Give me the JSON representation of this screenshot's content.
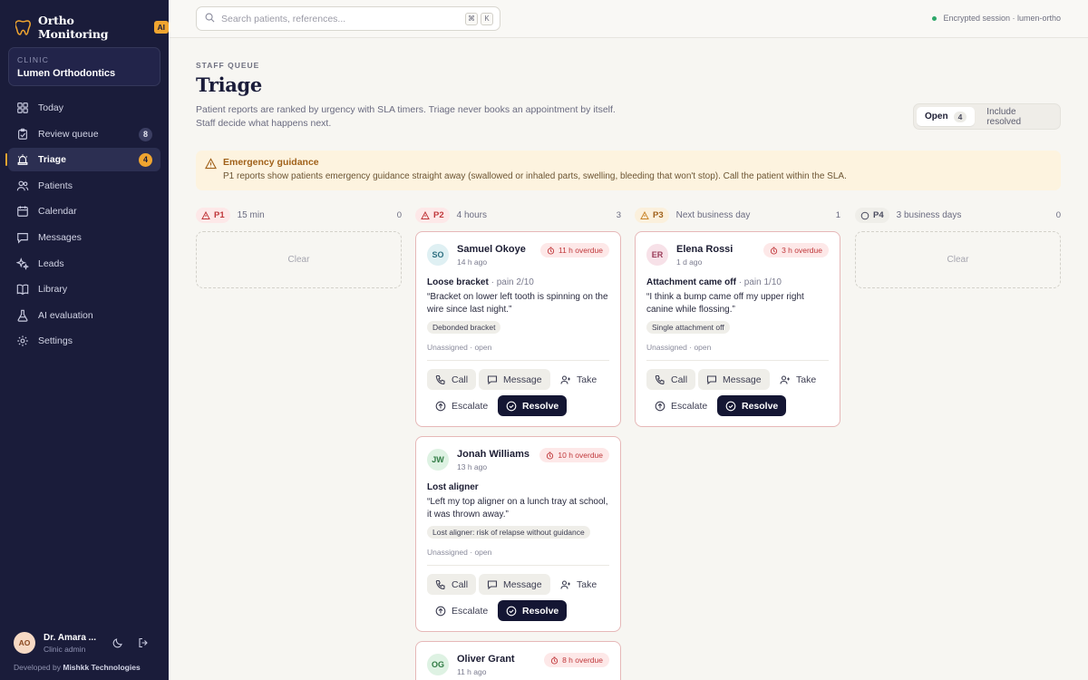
{
  "sidebar": {
    "brand": "Ortho Monitoring",
    "brand_badge": "AI",
    "clinic_caption": "CLINIC",
    "clinic_name": "Lumen Orthodontics",
    "nav": [
      {
        "label": "Today",
        "icon": "home-icon"
      },
      {
        "label": "Review queue",
        "icon": "clipboard-check-icon",
        "count": "8"
      },
      {
        "label": "Triage",
        "icon": "siren-icon",
        "count": "4"
      },
      {
        "label": "Patients",
        "icon": "users-icon"
      },
      {
        "label": "Calendar",
        "icon": "calendar-icon"
      },
      {
        "label": "Messages",
        "icon": "message-icon"
      },
      {
        "label": "Leads",
        "icon": "sparkle-icon"
      },
      {
        "label": "Library",
        "icon": "book-icon"
      },
      {
        "label": "AI evaluation",
        "icon": "flask-icon"
      },
      {
        "label": "Settings",
        "icon": "gear-icon"
      }
    ],
    "active_item": "Triage",
    "user": {
      "initials": "AO",
      "name": "Dr. Amara ...",
      "role": "Clinic admin"
    },
    "footer_prefix": "Developed by",
    "footer_company": "Mishkk Technologies"
  },
  "topbar": {
    "search_placeholder": "Search patients, references...",
    "shortcut_keys": [
      "⌘",
      "K"
    ],
    "session": "Encrypted session · lumen-ortho"
  },
  "header": {
    "eyebrow": "STAFF QUEUE",
    "title": "Triage",
    "description_1": "Patient reports are ranked by urgency with SLA timers. Triage never books an appointment by itself.",
    "description_2": "Staff decide what happens next.",
    "filter": {
      "open_label": "Open",
      "open_count": "4",
      "resolved_label": "Include resolved"
    }
  },
  "alert": {
    "title": "Emergency guidance",
    "body": "P1 reports show patients emergency guidance straight away (swallowed or inhaled parts, swelling, bleeding that won't stop). Call the patient within the SLA."
  },
  "columns": [
    {
      "priority": "P1",
      "sla": "15 min",
      "count": "0",
      "empty_label": "Clear"
    },
    {
      "priority": "P2",
      "sla": "4 hours",
      "count": "3"
    },
    {
      "priority": "P3",
      "sla": "Next business day",
      "count": "1"
    },
    {
      "priority": "P4",
      "sla": "3 business days",
      "count": "0",
      "empty_label": "Clear"
    }
  ],
  "cards": [
    {
      "initials": "SO",
      "name": "Samuel Okoye",
      "ago": "14 h ago",
      "overdue": "11 h overdue",
      "issue": "Loose bracket",
      "pain": "· pain 2/10",
      "quote": "“Bracket on lower left tooth is spinning on the wire since last night.”",
      "tag": "Debonded bracket",
      "assign": "Unassigned · open"
    },
    {
      "initials": "ER",
      "name": "Elena Rossi",
      "ago": "1 d ago",
      "overdue": "3 h overdue",
      "issue": "Attachment came off",
      "pain": "· pain 1/10",
      "quote": "“I think a bump came off my upper right canine while flossing.”",
      "tag": "Single attachment off",
      "assign": "Unassigned · open"
    },
    {
      "initials": "JW",
      "name": "Jonah Williams",
      "ago": "13 h ago",
      "overdue": "10 h overdue",
      "issue": "Lost aligner",
      "pain": "",
      "quote": "“Left my top aligner on a lunch tray at school, it was thrown away.”",
      "tag": "Lost aligner: risk of relapse without guidance",
      "assign": "Unassigned · open"
    },
    {
      "initials": "OG",
      "name": "Oliver Grant",
      "ago": "11 h ago",
      "overdue": "8 h overdue"
    }
  ],
  "actions": {
    "call": "Call",
    "message": "Message",
    "take": "Take",
    "escalate": "Escalate",
    "resolve": "Resolve"
  },
  "colors": {
    "sidebar_bg": "#1a1c3a",
    "accent": "#f0a530",
    "danger": "#c0383b",
    "resolve_bg": "#141633"
  }
}
